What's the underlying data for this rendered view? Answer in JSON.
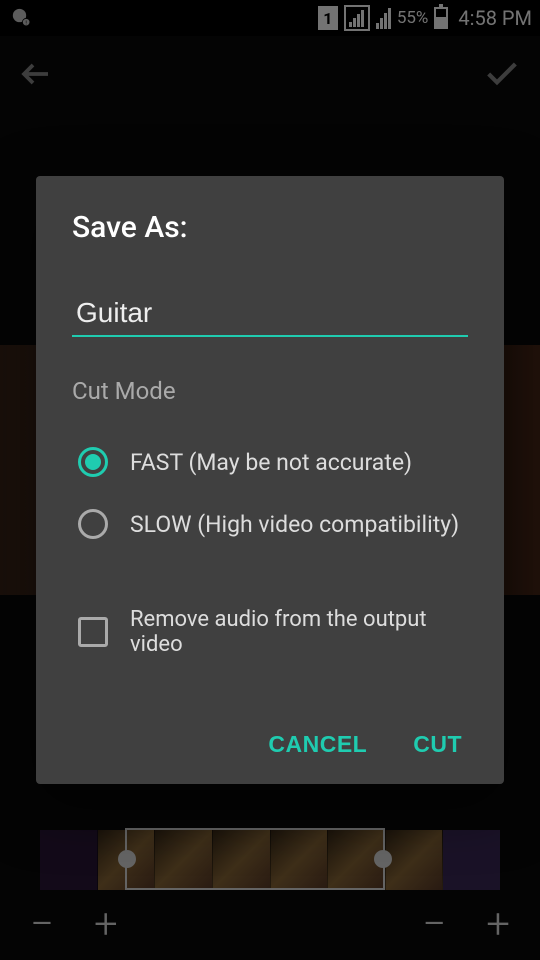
{
  "status": {
    "sim": "1",
    "battery_pct": "55%",
    "time": "4:58 PM"
  },
  "dialog": {
    "title": "Save As:",
    "filename": "Guitar",
    "section_label": "Cut Mode",
    "radio_fast": "FAST (May be not accurate)",
    "radio_slow": "SLOW (High video compatibility)",
    "checkbox_audio": "Remove audio from the output video",
    "cancel": "CANCEL",
    "cut": "CUT"
  },
  "controls": {
    "minus": "−",
    "plus": "+"
  }
}
